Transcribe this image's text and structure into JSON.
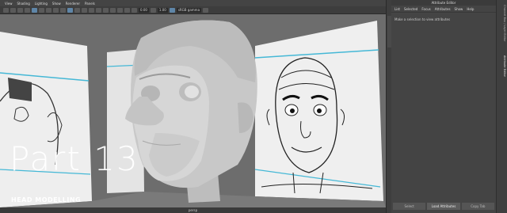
{
  "viewport": {
    "menu": [
      "View",
      "Shading",
      "Lighting",
      "Show",
      "Renderer",
      "Panels"
    ],
    "toolbar": {
      "field_a": "0.00",
      "field_b": "1.00",
      "colorspace": "sRGB gamma"
    },
    "camera_label": "persp"
  },
  "overlay": {
    "title": "Part 13",
    "series": "HEAD MODELLING"
  },
  "attribute_editor": {
    "title": "Attribute Editor",
    "menu": [
      "List",
      "Selected",
      "Focus",
      "Attributes",
      "Show",
      "Help"
    ],
    "message": "Make a selection to view attributes",
    "buttons": {
      "select": "Select",
      "load": "Load Attributes",
      "copy": "Copy Tab"
    }
  },
  "right_tabs": [
    "Channel Box / Layer Editor",
    "Attribute Editor"
  ],
  "colors": {
    "accent_line": "#45b8d6",
    "panel_bg": "#444444",
    "active_button": "#5f86a8"
  },
  "icons": [
    "select-tool-icon",
    "camera-icon",
    "grid-icon",
    "wireframe-icon",
    "smooth-shade-icon",
    "xray-icon"
  ]
}
